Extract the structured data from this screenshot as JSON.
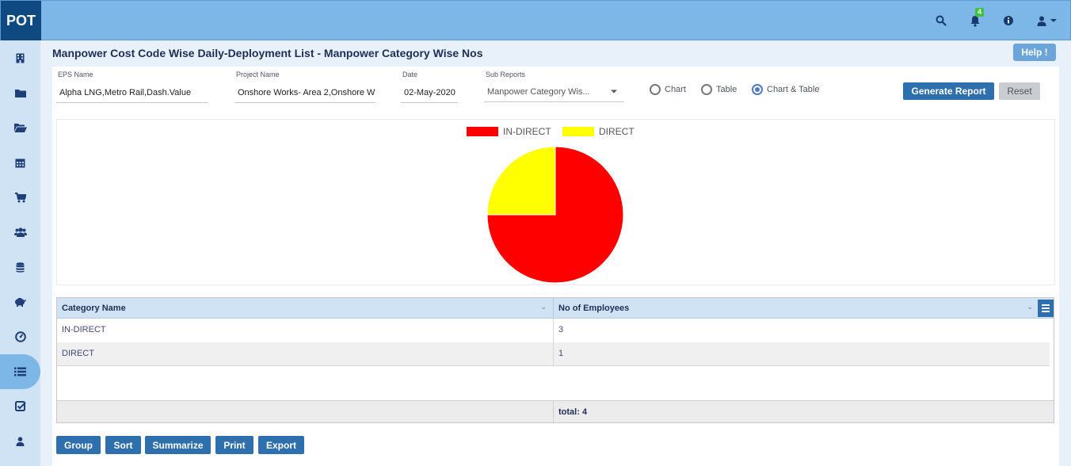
{
  "app": {
    "logo": "POT"
  },
  "header": {
    "notification_count": "4",
    "icons": [
      "search-icon",
      "bell-icon",
      "info-icon",
      "user-icon",
      "caret-down-icon"
    ]
  },
  "sidebar": {
    "items": [
      {
        "icon": "building-icon"
      },
      {
        "icon": "folder-icon"
      },
      {
        "icon": "folder-open-icon"
      },
      {
        "icon": "calendar-icon"
      },
      {
        "icon": "cart-icon"
      },
      {
        "icon": "users-icon"
      },
      {
        "icon": "database-icon"
      },
      {
        "icon": "piggy-bank-icon"
      },
      {
        "icon": "dashboard-icon"
      },
      {
        "icon": "list-icon",
        "active": true
      },
      {
        "icon": "checklist-icon"
      },
      {
        "icon": "user-icon"
      }
    ]
  },
  "page": {
    "title": "Manpower Cost Code Wise Daily-Deployment List - Manpower Category Wise Nos",
    "help_label": "Help !"
  },
  "filters": {
    "eps": {
      "label": "EPS Name",
      "value": "Alpha LNG,Metro Rail,Dash.Value"
    },
    "project": {
      "label": "Project Name",
      "value": "Onshore  Works- Area 2,Onshore  W"
    },
    "date": {
      "label": "Date",
      "value": "02-May-2020"
    },
    "subreport": {
      "label": "Sub Reports",
      "value": "Manpower Category Wis..."
    },
    "view_options": [
      {
        "label": "Chart",
        "selected": false
      },
      {
        "label": "Table",
        "selected": false
      },
      {
        "label": "Chart & Table",
        "selected": true
      }
    ],
    "generate_label": "Generate Report",
    "reset_label": "Reset"
  },
  "chart_data": {
    "type": "pie",
    "categories": [
      "IN-DIRECT",
      "DIRECT"
    ],
    "values": [
      3,
      1
    ],
    "colors": [
      "#ff0000",
      "#ffff00"
    ],
    "legend": [
      "IN-DIRECT",
      "DIRECT"
    ],
    "legend_position": "top"
  },
  "grid": {
    "columns": [
      "Category Name",
      "No of Employees"
    ],
    "rows": [
      [
        "IN-DIRECT",
        "3"
      ],
      [
        "DIRECT",
        "1"
      ]
    ],
    "total": "total: 4"
  },
  "toolbar": {
    "group": "Group",
    "sort": "Sort",
    "summarize": "Summarize",
    "print": "Print",
    "export": "Export"
  }
}
